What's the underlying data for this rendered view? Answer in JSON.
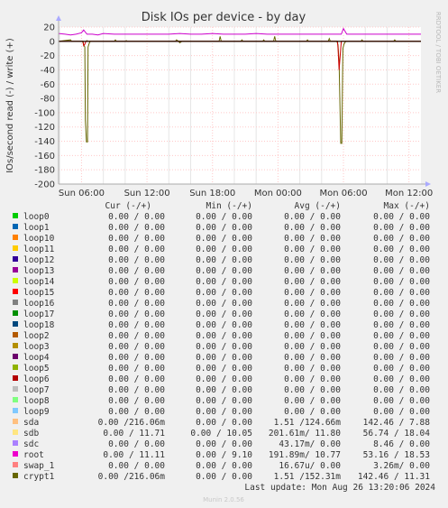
{
  "chart_data": {
    "type": "line",
    "title": "Disk IOs per device - by day",
    "ylabel": "IOs/second read (-) / write (+)",
    "side_label": "RRDTOOL / TOBI OETIKER",
    "ylim": [
      -200,
      20
    ],
    "yticks": [
      20,
      0,
      -20,
      -40,
      -60,
      -80,
      -100,
      -120,
      -140,
      -160,
      -180,
      -200
    ],
    "xticks": [
      "Sun 06:00",
      "Sun 12:00",
      "Sun 18:00",
      "Mon 00:00",
      "Mon 06:00",
      "Mon 12:00"
    ],
    "xtick_hours": [
      0,
      6,
      12,
      18,
      24,
      30
    ],
    "xlim_hours": [
      -2.1,
      31.1
    ],
    "grid": true,
    "series": [
      {
        "name": "root",
        "color": "#cc00cc",
        "baseline": 10,
        "points": [
          [
            -2.1,
            11
          ],
          [
            -1.5,
            10
          ],
          [
            -1.0,
            9
          ],
          [
            -0.5,
            10
          ],
          [
            0.0,
            12
          ],
          [
            0.2,
            16
          ],
          [
            0.5,
            10
          ],
          [
            1.0,
            10
          ],
          [
            1.5,
            9
          ],
          [
            2.0,
            11
          ],
          [
            3,
            10
          ],
          [
            4,
            10
          ],
          [
            5,
            10
          ],
          [
            6,
            10
          ],
          [
            7,
            10
          ],
          [
            8,
            10
          ],
          [
            9,
            11
          ],
          [
            10,
            10
          ],
          [
            11,
            10
          ],
          [
            12,
            11
          ],
          [
            13,
            10
          ],
          [
            14,
            10
          ],
          [
            15,
            10
          ],
          [
            16,
            11
          ],
          [
            17,
            10
          ],
          [
            18,
            10
          ],
          [
            19,
            10
          ],
          [
            20,
            10
          ],
          [
            21,
            10
          ],
          [
            22,
            10
          ],
          [
            23,
            10
          ],
          [
            23.8,
            10
          ],
          [
            24.0,
            18
          ],
          [
            24.3,
            10
          ],
          [
            25,
            10
          ],
          [
            26,
            10
          ],
          [
            27,
            10
          ],
          [
            28,
            10
          ],
          [
            29,
            10
          ],
          [
            30,
            10
          ],
          [
            31.1,
            10
          ]
        ]
      },
      {
        "name": "sda write",
        "color": "#666600",
        "baseline": 0,
        "points": [
          [
            -2.1,
            0
          ],
          [
            -1.0,
            2
          ],
          [
            -0.9,
            0
          ],
          [
            0.4,
            0
          ],
          [
            0.5,
            1
          ],
          [
            0.6,
            0
          ],
          [
            3.0,
            0
          ],
          [
            3.1,
            2
          ],
          [
            3.2,
            0
          ],
          [
            4.0,
            0
          ],
          [
            4.1,
            1
          ],
          [
            4.2,
            0
          ],
          [
            8.6,
            0
          ],
          [
            8.7,
            2
          ],
          [
            8.9,
            0
          ],
          [
            9.0,
            -2
          ],
          [
            9.2,
            0
          ],
          [
            12.6,
            0
          ],
          [
            12.7,
            7
          ],
          [
            12.8,
            0
          ],
          [
            14.6,
            0
          ],
          [
            14.7,
            2
          ],
          [
            14.8,
            0
          ],
          [
            16.6,
            0
          ],
          [
            16.7,
            2
          ],
          [
            16.8,
            0
          ],
          [
            17.6,
            0
          ],
          [
            17.7,
            7
          ],
          [
            17.8,
            0
          ],
          [
            20.6,
            0
          ],
          [
            20.7,
            2
          ],
          [
            20.8,
            0
          ],
          [
            22.6,
            0
          ],
          [
            22.7,
            4
          ],
          [
            22.8,
            0
          ],
          [
            25.6,
            0
          ],
          [
            25.7,
            2
          ],
          [
            25.8,
            0
          ],
          [
            28.6,
            0
          ],
          [
            28.7,
            2
          ],
          [
            28.8,
            0
          ],
          [
            31.1,
            0
          ]
        ]
      },
      {
        "name": "sda read",
        "color": "#666600",
        "baseline": 0,
        "points": [
          [
            -2.1,
            0
          ],
          [
            0.1,
            0
          ],
          [
            0.2,
            -5
          ],
          [
            0.3,
            -8
          ],
          [
            0.35,
            -110
          ],
          [
            0.45,
            -141
          ],
          [
            0.55,
            -141
          ],
          [
            0.6,
            -8
          ],
          [
            0.7,
            -3
          ],
          [
            0.8,
            0
          ],
          [
            23.4,
            0
          ],
          [
            23.5,
            -5
          ],
          [
            23.6,
            -30
          ],
          [
            23.75,
            -143
          ],
          [
            23.85,
            -143
          ],
          [
            23.95,
            -10
          ],
          [
            24.05,
            -4
          ],
          [
            24.2,
            0
          ],
          [
            31.1,
            0
          ]
        ]
      },
      {
        "name": "sda read accent",
        "color": "#cc0000",
        "baseline": 0,
        "points": [
          [
            -2.1,
            0
          ],
          [
            0.15,
            0
          ],
          [
            0.2,
            -6
          ],
          [
            0.3,
            -4
          ],
          [
            0.4,
            0
          ],
          [
            23.45,
            0
          ],
          [
            23.5,
            -10
          ],
          [
            23.6,
            -40
          ],
          [
            23.7,
            -20
          ],
          [
            23.8,
            0
          ],
          [
            31.1,
            0
          ]
        ]
      }
    ]
  },
  "legend": {
    "headers": {
      "cur": "Cur (-/+)",
      "min": "Min (-/+)",
      "avg": "Avg (-/+)",
      "max": "Max (-/+)"
    },
    "rows": [
      {
        "name": "loop0",
        "color": "#00cc00",
        "cur": "0.00 /  0.00",
        "min": "0.00 /  0.00",
        "avg": "0.00 /  0.00",
        "max": "0.00 /  0.00"
      },
      {
        "name": "loop1",
        "color": "#0066b3",
        "cur": "0.00 /  0.00",
        "min": "0.00 /  0.00",
        "avg": "0.00 /  0.00",
        "max": "0.00 /  0.00"
      },
      {
        "name": "loop10",
        "color": "#ff8000",
        "cur": "0.00 /  0.00",
        "min": "0.00 /  0.00",
        "avg": "0.00 /  0.00",
        "max": "0.00 /  0.00"
      },
      {
        "name": "loop11",
        "color": "#ffcc00",
        "cur": "0.00 /  0.00",
        "min": "0.00 /  0.00",
        "avg": "0.00 /  0.00",
        "max": "0.00 /  0.00"
      },
      {
        "name": "loop12",
        "color": "#330099",
        "cur": "0.00 /  0.00",
        "min": "0.00 /  0.00",
        "avg": "0.00 /  0.00",
        "max": "0.00 /  0.00"
      },
      {
        "name": "loop13",
        "color": "#990099",
        "cur": "0.00 /  0.00",
        "min": "0.00 /  0.00",
        "avg": "0.00 /  0.00",
        "max": "0.00 /  0.00"
      },
      {
        "name": "loop14",
        "color": "#ccff00",
        "cur": "0.00 /  0.00",
        "min": "0.00 /  0.00",
        "avg": "0.00 /  0.00",
        "max": "0.00 /  0.00"
      },
      {
        "name": "loop15",
        "color": "#ff0000",
        "cur": "0.00 /  0.00",
        "min": "0.00 /  0.00",
        "avg": "0.00 /  0.00",
        "max": "0.00 /  0.00"
      },
      {
        "name": "loop16",
        "color": "#808080",
        "cur": "0.00 /  0.00",
        "min": "0.00 /  0.00",
        "avg": "0.00 /  0.00",
        "max": "0.00 /  0.00"
      },
      {
        "name": "loop17",
        "color": "#008f00",
        "cur": "0.00 /  0.00",
        "min": "0.00 /  0.00",
        "avg": "0.00 /  0.00",
        "max": "0.00 /  0.00"
      },
      {
        "name": "loop18",
        "color": "#00487d",
        "cur": "0.00 /  0.00",
        "min": "0.00 /  0.00",
        "avg": "0.00 /  0.00",
        "max": "0.00 /  0.00"
      },
      {
        "name": "loop2",
        "color": "#b35a00",
        "cur": "0.00 /  0.00",
        "min": "0.00 /  0.00",
        "avg": "0.00 /  0.00",
        "max": "0.00 /  0.00"
      },
      {
        "name": "loop3",
        "color": "#b38f00",
        "cur": "0.00 /  0.00",
        "min": "0.00 /  0.00",
        "avg": "0.00 /  0.00",
        "max": "0.00 /  0.00"
      },
      {
        "name": "loop4",
        "color": "#6b006b",
        "cur": "0.00 /  0.00",
        "min": "0.00 /  0.00",
        "avg": "0.00 /  0.00",
        "max": "0.00 /  0.00"
      },
      {
        "name": "loop5",
        "color": "#8fb300",
        "cur": "0.00 /  0.00",
        "min": "0.00 /  0.00",
        "avg": "0.00 /  0.00",
        "max": "0.00 /  0.00"
      },
      {
        "name": "loop6",
        "color": "#b30000",
        "cur": "0.00 /  0.00",
        "min": "0.00 /  0.00",
        "avg": "0.00 /  0.00",
        "max": "0.00 /  0.00"
      },
      {
        "name": "loop7",
        "color": "#bebebe",
        "cur": "0.00 /  0.00",
        "min": "0.00 /  0.00",
        "avg": "0.00 /  0.00",
        "max": "0.00 /  0.00"
      },
      {
        "name": "loop8",
        "color": "#80ff80",
        "cur": "0.00 /  0.00",
        "min": "0.00 /  0.00",
        "avg": "0.00 /  0.00",
        "max": "0.00 /  0.00"
      },
      {
        "name": "loop9",
        "color": "#80c9ff",
        "cur": "0.00 /  0.00",
        "min": "0.00 /  0.00",
        "avg": "0.00 /  0.00",
        "max": "0.00 /  0.00"
      },
      {
        "name": "sda",
        "color": "#ffc080",
        "cur": "0.00 /216.06m",
        "min": "0.00 /  0.00",
        "avg": "1.51 /124.66m",
        "max": "142.46 /  7.88"
      },
      {
        "name": "sdb",
        "color": "#ffe680",
        "cur": "0.00 / 11.71",
        "min": "0.00 / 10.05",
        "avg": "201.61m/ 11.80",
        "max": "56.74 / 18.04"
      },
      {
        "name": "sdc",
        "color": "#aa80ff",
        "cur": "0.00 /  0.00",
        "min": "0.00 /  0.00",
        "avg": "43.17m/  0.00",
        "max": "8.46 /  0.00"
      },
      {
        "name": "root",
        "color": "#ee00cc",
        "cur": "0.00 / 11.11",
        "min": "0.00 /  9.10",
        "avg": "191.89m/ 10.77",
        "max": "53.16 / 18.53"
      },
      {
        "name": "swap_1",
        "color": "#ff8080",
        "cur": "0.00 /  0.00",
        "min": "0.00 /  0.00",
        "avg": "16.67u/  0.00",
        "max": "3.26m/  0.00"
      },
      {
        "name": "crypt1",
        "color": "#666600",
        "cur": "0.00 /216.06m",
        "min": "0.00 /  0.00",
        "avg": "1.51 /152.31m",
        "max": "142.46 / 11.31"
      }
    ]
  },
  "footer": {
    "last_update": "Last update: Mon Aug 26 13:20:06 2024",
    "munin": "Munin 2.0.56"
  }
}
